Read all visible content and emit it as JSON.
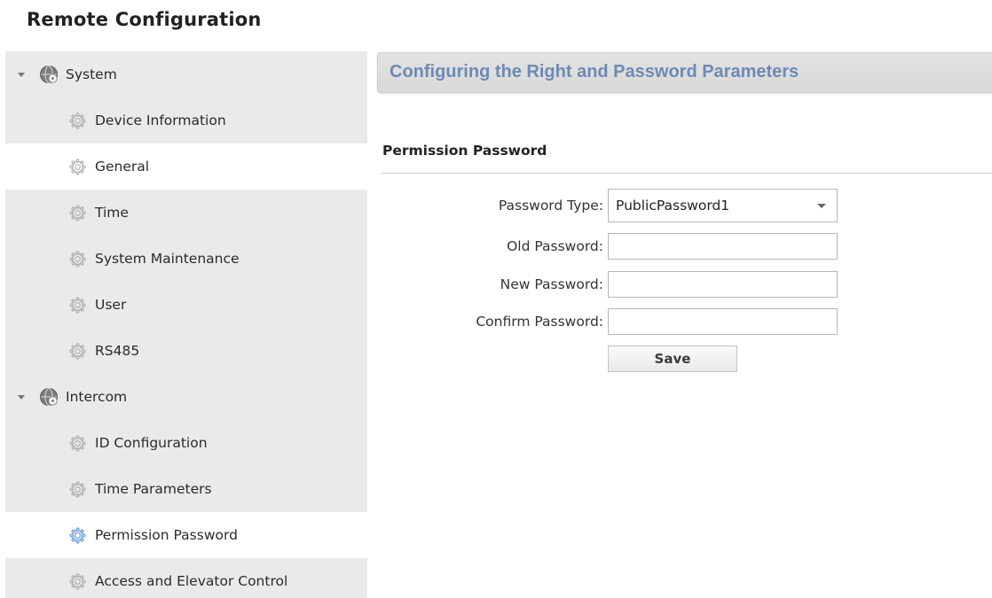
{
  "app": {
    "title": "Remote Configuration"
  },
  "sidebar": {
    "groups": [
      {
        "label": "System",
        "expanded": true,
        "icon": "globe-icon",
        "items": [
          {
            "label": "Device Information",
            "icon": "gear-icon",
            "selected": false
          },
          {
            "label": "General",
            "icon": "gear-icon",
            "selected": false,
            "highlighted": true
          },
          {
            "label": "Time",
            "icon": "gear-icon",
            "selected": false
          },
          {
            "label": "System Maintenance",
            "icon": "gear-icon",
            "selected": false
          },
          {
            "label": "User",
            "icon": "gear-icon",
            "selected": false
          },
          {
            "label": "RS485",
            "icon": "gear-icon",
            "selected": false
          }
        ]
      },
      {
        "label": "Intercom",
        "expanded": true,
        "icon": "globe-icon",
        "items": [
          {
            "label": "ID Configuration",
            "icon": "gear-icon",
            "selected": false
          },
          {
            "label": "Time Parameters",
            "icon": "gear-icon",
            "selected": false
          },
          {
            "label": "Permission Password",
            "icon": "gear-icon",
            "selected": true
          },
          {
            "label": "Access and Elevator Control",
            "icon": "gear-icon",
            "selected": false
          }
        ]
      }
    ]
  },
  "main": {
    "header_title": "Configuring the Right and Password Parameters",
    "section_title": "Permission Password",
    "form": {
      "password_type_label": "Password Type:",
      "password_type_value": "PublicPassword1",
      "old_password_label": "Old Password:",
      "old_password_value": "",
      "new_password_label": "New Password:",
      "new_password_value": "",
      "confirm_password_label": "Confirm Password:",
      "confirm_password_value": "",
      "save_label": "Save"
    }
  },
  "colors": {
    "header_title": "#6d8ab4",
    "sidebar_bg": "#eaeaea",
    "selected_row_bg": "#ffffff",
    "active_gear_icon": "#6f9ad3",
    "inactive_gear_icon": "#a8a8a8"
  }
}
